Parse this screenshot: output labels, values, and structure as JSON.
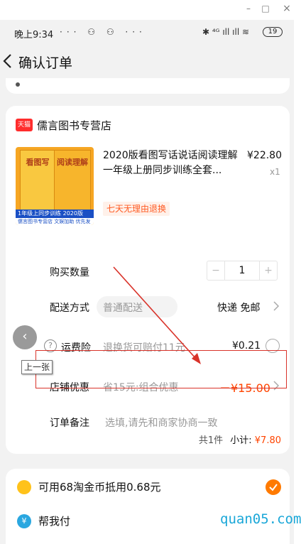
{
  "window": {
    "minimize": "–",
    "maximize": "□",
    "close": "×"
  },
  "status_bar": {
    "time": "晚上9:34",
    "icons": "··· ⚇ ⚇ ···",
    "right_icons": "✱ ⁴ᴳ ıll ıll ≋",
    "battery": "19"
  },
  "nav": {
    "title": "确认订单"
  },
  "shop": {
    "logo_text": "天猫",
    "name": "儒言图书专营店"
  },
  "product": {
    "cover_title_1": "看图写",
    "cover_title_2": "阅读理解",
    "cover_ribbon": "1年级上同步训练 2020版",
    "cover_store": "儒言图书专营店 文娱加助 优先发货",
    "title": "2020版看图写话说话阅读理解一年级上册同步训练全套...",
    "price": "¥22.80",
    "quantity": "x1",
    "return_tag": "七天无理由退换"
  },
  "rows": {
    "quantity": {
      "label": "购买数量",
      "minus": "−",
      "value": "1",
      "plus": "+"
    },
    "delivery": {
      "label": "配送方式",
      "option": "普通配送",
      "value": "快递 免邮"
    },
    "insurance": {
      "icon_text": "?",
      "label": "运费险",
      "desc": "退换货可赔付11元",
      "price": "¥0.21"
    },
    "promotion": {
      "label": "店铺优惠",
      "desc": "省15元:组合优惠",
      "price": "－¥15.00"
    },
    "remark": {
      "label": "订单备注",
      "placeholder": "选填,请先和商家协商一致"
    }
  },
  "subtotal": {
    "count": "共1件",
    "label": "小计:",
    "value": "¥7.80"
  },
  "overlay": {
    "prev_arrow": "‹",
    "tooltip": "上一张"
  },
  "extras": {
    "coin": {
      "label": "可用68淘金币抵用0.68元"
    },
    "helppay": {
      "icon_text": "¥",
      "label": "帮我付"
    }
  },
  "watermark": "quan05.com",
  "colors": {
    "accent": "#ff4400",
    "tmall_red": "#ff2d2d",
    "coin_check": "#ff7a00",
    "annotation": "#d9332a"
  }
}
